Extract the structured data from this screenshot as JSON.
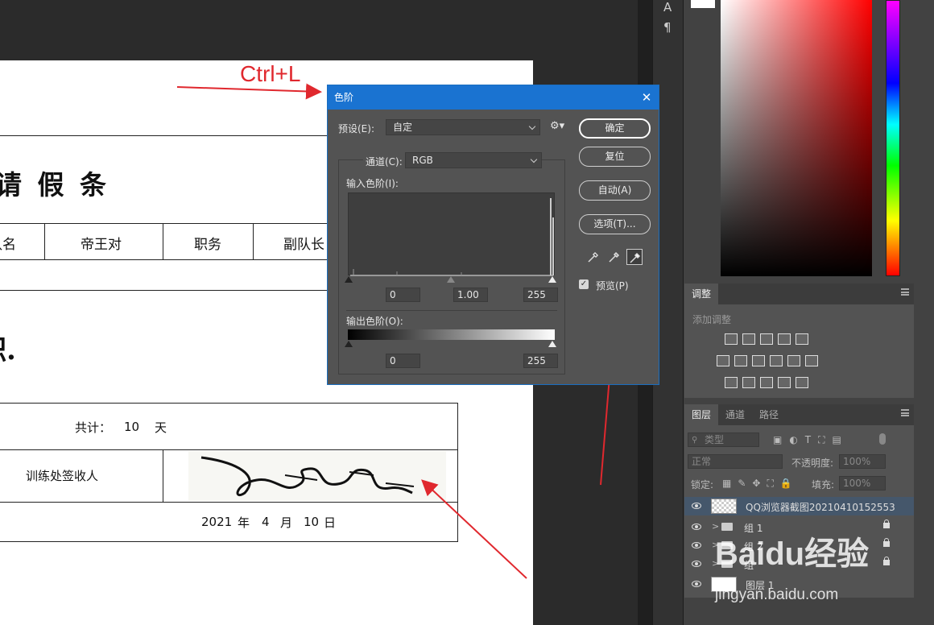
{
  "annotation": {
    "shortcut_text": "Ctrl+L",
    "color": "#e0282e"
  },
  "document": {
    "title": "请 假 条",
    "row1": {
      "col1": "队名",
      "col2": "帝王对",
      "col3": "职务",
      "col4": "副队长"
    },
    "fragment": "职.",
    "total": {
      "label": "共计：",
      "value": "10",
      "unit": "天"
    },
    "signer_label": "训练处签收人",
    "date": {
      "year": "2021",
      "year_unit": "年",
      "month": "4",
      "month_unit": "月",
      "day": "10",
      "day_unit": "日"
    }
  },
  "tools": {
    "type_tool_glyph": "A",
    "paragraph_glyph": "¶"
  },
  "levels_dialog": {
    "title": "色阶",
    "preset_label": "预设(E):",
    "preset_value": "自定",
    "channel_label": "通道(C):",
    "channel_value": "RGB",
    "input_levels_label": "输入色阶(I):",
    "input_values": [
      "0",
      "1.00",
      "255"
    ],
    "output_levels_label": "输出色阶(O):",
    "output_values": [
      "0",
      "255"
    ],
    "buttons": {
      "ok": "确定",
      "reset": "复位",
      "auto": "自动(A)",
      "options": "选项(T)..."
    },
    "preview_label": "预览(P)",
    "preview_checked": true
  },
  "adjustments_panel": {
    "tab": "调整",
    "add_label": "添加调整"
  },
  "layers_panel": {
    "tabs": [
      "图层",
      "通道",
      "路径"
    ],
    "filter_label": "类型",
    "blend_mode": "正常",
    "opacity_label": "不透明度:",
    "opacity_value": "100%",
    "lock_label": "锁定:",
    "fill_label": "填充:",
    "fill_value": "100%",
    "layers": [
      {
        "name": "QQ浏览器截图20210410152553",
        "selected": true
      },
      {
        "name": "组 1",
        "group": true
      },
      {
        "name": "组 2",
        "group": true
      },
      {
        "name": "组",
        "group": true
      },
      {
        "name": "图层 1"
      }
    ]
  },
  "watermark": {
    "brand": "Baidu经验",
    "url": "jingyan.baidu.com"
  }
}
